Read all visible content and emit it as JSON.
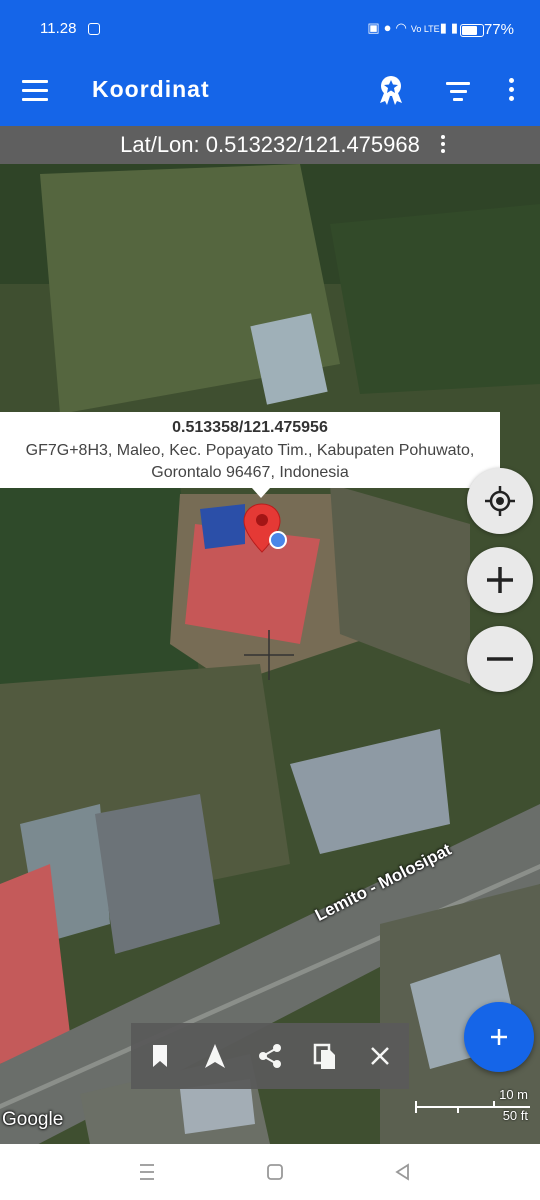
{
  "status_bar": {
    "time": "11.28",
    "battery": "77%",
    "network": "Vo LTE"
  },
  "app_bar": {
    "title": "Koordinat",
    "icons": [
      "menu-icon",
      "badge-icon",
      "filter-icon",
      "more-vert-icon"
    ]
  },
  "coord_bar": {
    "text": "Lat/Lon: 0.513232/121.475968"
  },
  "popup": {
    "coords": "0.513358/121.475956",
    "address": "GF7G+8H3, Maleo, Kec. Popayato Tim., Kabupaten Pohuwato, Gorontalo 96467, Indonesia"
  },
  "map": {
    "road_label": "Lemito - Molosipat",
    "logo": "Google",
    "scale_metric": "10 m",
    "scale_imperial": "50 ft",
    "colors": {
      "pin": "#e53935",
      "location_dot": "#4a86e8",
      "accent": "#1565e8"
    }
  },
  "toolbar": {
    "icons": [
      "bookmark-icon",
      "navigate-icon",
      "share-icon",
      "copy-icon",
      "close-icon"
    ]
  },
  "fab": {
    "icon": "plus-icon"
  },
  "nav_bar": {
    "icons": [
      "recents-icon",
      "home-icon",
      "back-icon"
    ]
  }
}
